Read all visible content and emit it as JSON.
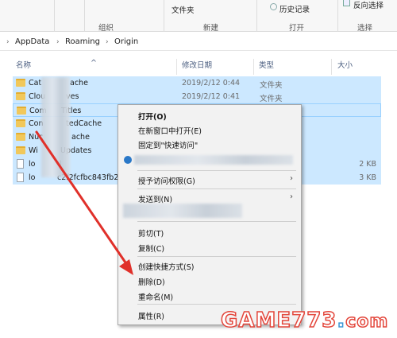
{
  "ribbon": {
    "groups": [
      {
        "label": "组织"
      },
      {
        "label": "新建"
      },
      {
        "label": "打开"
      },
      {
        "label": "选择"
      }
    ],
    "new_folder_label": "文件夹",
    "history_label": "历史记录",
    "invert_select_label": "反向选择"
  },
  "address": {
    "crumbs": [
      "AppData",
      "Roaming",
      "Origin"
    ]
  },
  "columns": {
    "name": "名称",
    "date": "修改日期",
    "type": "类型",
    "size": "大小"
  },
  "rows": [
    {
      "name_start": "Cat",
      "name_end": "ache",
      "date": "2019/2/12 0:44",
      "type": "文件夹",
      "size": "",
      "kind": "folder"
    },
    {
      "name_start": "Clou",
      "name_end": "ves",
      "date": "2019/2/12 0:41",
      "type": "文件夹",
      "size": "",
      "kind": "folder"
    },
    {
      "name_start": "Com",
      "name_end": "Titles",
      "date": "",
      "type": "",
      "size": "",
      "kind": "folder"
    },
    {
      "name_start": "Con",
      "name_end": "tedCache",
      "date": "",
      "type": "",
      "size": "",
      "kind": "folder"
    },
    {
      "name_start": "Nuc",
      "name_end": "ache",
      "date": "",
      "type": "",
      "size": "",
      "kind": "folder"
    },
    {
      "name_start": "Wi",
      "name_end": "Updates",
      "date": "",
      "type": "",
      "size": "",
      "kind": "folder"
    },
    {
      "name_start": "lo",
      "name_end": "l",
      "date": "",
      "type": "",
      "size": "2 KB",
      "kind": "file"
    },
    {
      "name_start": "lo",
      "name_end": "c2f2fcfbc843fb2",
      "date": "",
      "type": "",
      "size": "3 KB",
      "kind": "file"
    }
  ],
  "context_menu": {
    "open": "打开(O)",
    "open_new_window": "在新窗口中打开(E)",
    "pin_quick_access": "固定到\"快速访问\"",
    "grant_access": "授予访问权限(G)",
    "send_to": "发送到(N)",
    "cut": "剪切(T)",
    "copy": "复制(C)",
    "create_shortcut": "创建快捷方式(S)",
    "delete": "删除(D)",
    "rename": "重命名(M)",
    "properties": "属性(R)"
  },
  "watermark": {
    "text": "GAME773",
    "dot": ".",
    "tld": "com"
  },
  "colors": {
    "selection": "#cce8ff",
    "menu_bg": "#f2f2f2",
    "annotation_arrow": "#e0302a",
    "header_text": "#4d6082"
  }
}
